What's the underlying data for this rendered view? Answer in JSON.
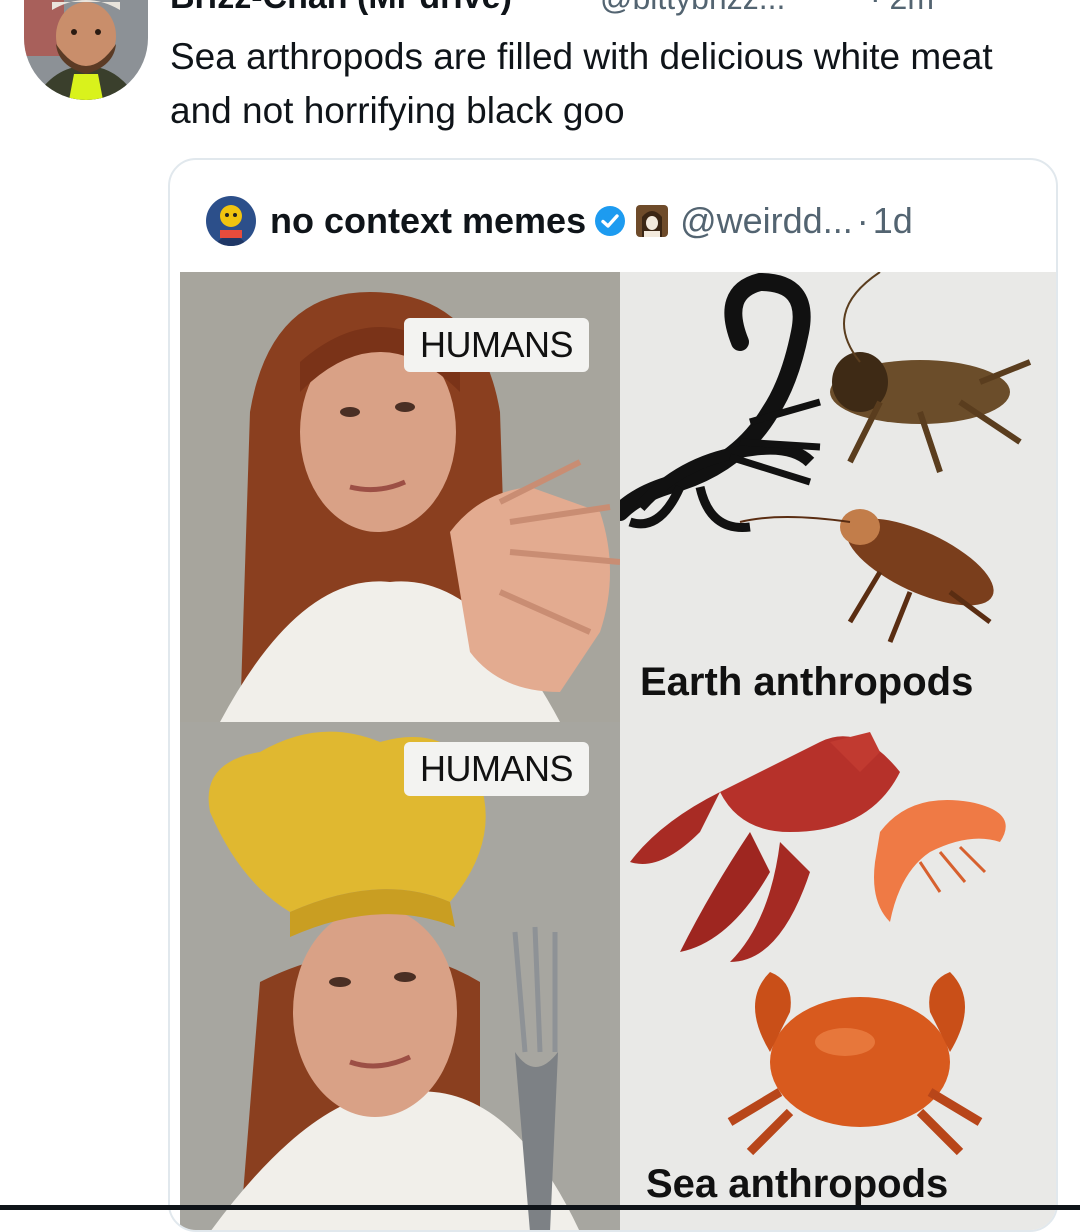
{
  "tweet": {
    "author_name": "Brizz-Chan (Mr drive)",
    "author_handle": "@bittybrizz...",
    "time": "· 2m",
    "text": "Sea arthropods are filled with delicious white meat and not horrifying black goo"
  },
  "quote": {
    "name": "no context memes",
    "handle": "@weirdd...",
    "separator": "·",
    "time": "1d"
  },
  "meme": {
    "top_label": "HUMANS",
    "bottom_label": "HUMANS",
    "earth_caption": "Earth anthropods",
    "sea_caption": "Sea anthropods"
  },
  "icons": {
    "verified": "verified-badge-icon",
    "flag": "user-emoji-icon",
    "grok": "grok-icon",
    "more": "more-icon"
  },
  "colors": {
    "verified_blue": "#1d9bf0",
    "secondary_text": "#536471"
  }
}
